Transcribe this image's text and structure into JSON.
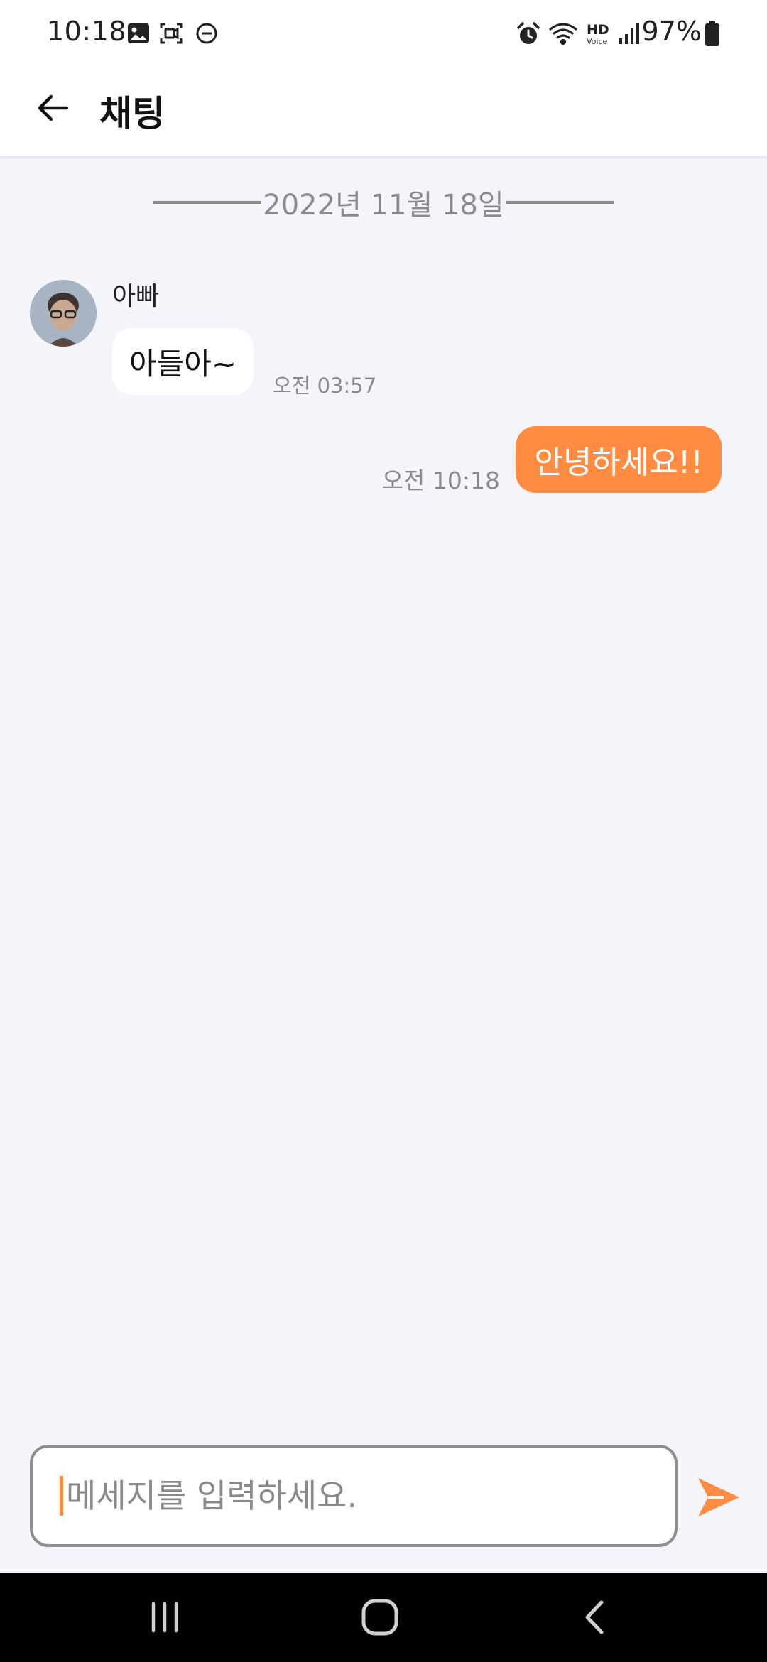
{
  "status_bar": {
    "time": "10:18",
    "battery": "97%",
    "left_icons": [
      "gallery-icon",
      "screen-record-icon",
      "do-not-disturb-icon"
    ],
    "right_icons": [
      "alarm-icon",
      "wifi-icon",
      "hd-voice-icon",
      "signal-icon",
      "battery-icon"
    ],
    "hd_label": "HD",
    "voice_label": "Voice"
  },
  "header": {
    "title": "채팅",
    "back_icon": "arrow-left-icon"
  },
  "chat": {
    "date": "2022년 11월 18일",
    "messages": [
      {
        "direction": "incoming",
        "sender": "아빠",
        "text": "아들아~",
        "time": "오전 03:57"
      },
      {
        "direction": "outgoing",
        "text": "안녕하세요!!",
        "time": "오전 10:18"
      }
    ]
  },
  "composer": {
    "placeholder": "메세지를 입력하세요.",
    "value": "",
    "send_icon": "send-icon"
  },
  "nav_bar": {
    "buttons": [
      "recent-apps-icon",
      "home-icon",
      "back-icon"
    ]
  },
  "colors": {
    "accent": "#ff8c42",
    "background": "#f4f5fa",
    "muted_text": "#8a8a8a"
  }
}
